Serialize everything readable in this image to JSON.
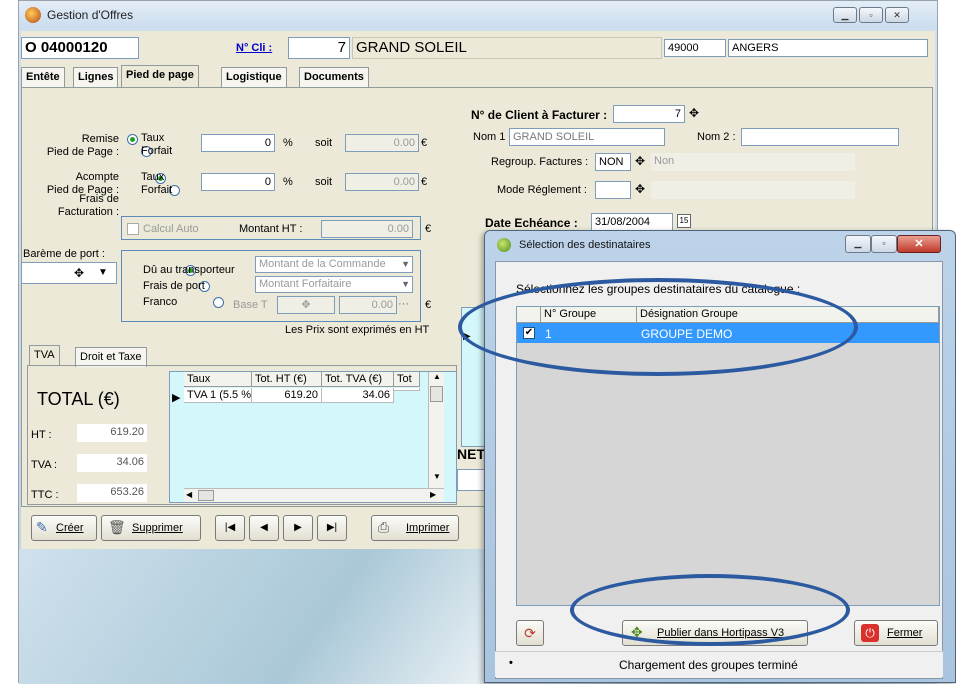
{
  "main_window": {
    "title": "Gestion d'Offres",
    "offer_number": "O 04000120",
    "client_link": "N° Cli :",
    "client_num": "7",
    "client_name": "GRAND SOLEIL",
    "postal_code": "49000",
    "city": "ANGERS"
  },
  "tabs": [
    {
      "label": "Entête"
    },
    {
      "label": "Lignes"
    },
    {
      "label": "Pied de page"
    },
    {
      "label": "Logistique"
    },
    {
      "label": "Documents"
    }
  ],
  "footer": {
    "remise_label": "Remise\nPied de Page :",
    "acompte_label": "Acompte\nPied de Page :",
    "taux": "Taux",
    "forfait": "Forfait",
    "remise_value": "0",
    "acompte_value": "0",
    "percent": "%",
    "soit": "soit",
    "remise_soit": "0.00",
    "acompte_soit": "0.00",
    "euro": "€",
    "frais_label": "Frais de\nFacturation :",
    "calcul_auto": "Calcul Auto",
    "montant_ht_label": "Montant HT :",
    "montant_ht_value": "0.00",
    "bareme_label": "Barème de port :",
    "du_transporteur": "Dû au transporteur",
    "frais_port": "Frais de port",
    "franco": "Franco",
    "montant_commande": "Montant de la Commande",
    "montant_forfaitaire": "Montant Forfaitaire",
    "base_t": "Base T",
    "base_value": "0.00",
    "prix_note": "Les Prix sont exprimés en HT"
  },
  "billing": {
    "client_facturer_label": "N° de Client à Facturer :",
    "client_facturer_value": "7",
    "nom1_label": "Nom 1 :",
    "nom1_value": "GRAND SOLEIL",
    "nom2_label": "Nom 2 :",
    "regroup_label": "Regroup. Factures :",
    "regroup_value": "NON",
    "regroup_desc": "Non",
    "mode_label": "Mode Réglement :",
    "date_label": "Date Echéance :",
    "date_value": "31/08/2004",
    "net_label": "NET"
  },
  "tva": {
    "tab1": "TVA",
    "tab2": "Droit et Taxe",
    "total_label": "TOTAL",
    "currency": "(€)",
    "ht_label": "HT :",
    "ht_value": "619.20",
    "tva_label": "TVA :",
    "tva_value": "34.06",
    "ttc_label": "TTC :",
    "ttc_value": "653.26",
    "columns": [
      "Taux",
      "Tot. HT (€)",
      "Tot. TVA (€)",
      "Tot"
    ],
    "rows": [
      {
        "taux": "TVA 1 (5.5 %",
        "tot_ht": "619.20",
        "tot_tva": "34.06",
        "tot": ""
      }
    ]
  },
  "toolbar": {
    "creer": "Créer",
    "supprimer": "Supprimer",
    "imprimer": "Imprimer"
  },
  "dialog": {
    "title": "Sélection des destinataires",
    "instruction": "Sélectionnez les groupes destinataires du catalogue :",
    "columns": [
      "N° Groupe",
      "Désignation Groupe"
    ],
    "rows": [
      {
        "checked": true,
        "num": "1",
        "designation": "GROUPE DEMO"
      }
    ],
    "publish_button": "Publier dans Hortipass V3",
    "close_button": "Fermer",
    "status": "Chargement des groupes terminé",
    "status_icon": "•"
  },
  "colors": {
    "selection": "#3399ff",
    "annotation_oval": "#2c5aa0",
    "grid_bg": "#d4f7fb"
  }
}
